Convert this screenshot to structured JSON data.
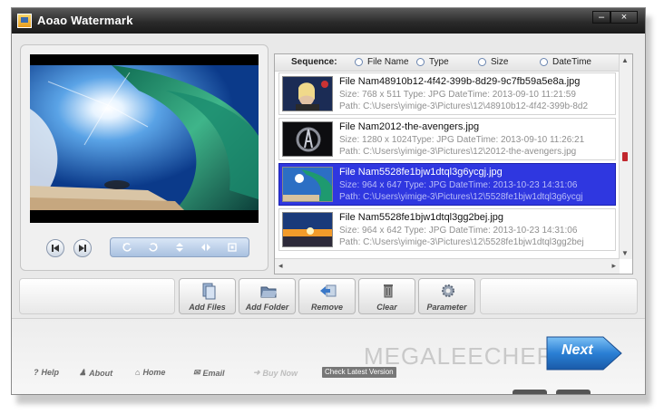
{
  "window": {
    "title": "Aoao Watermark",
    "controls": {
      "minimize": "–",
      "close": "×"
    }
  },
  "player": {
    "controls": [
      "skip-back-icon",
      "skip-forward-icon"
    ],
    "tools": [
      "rotate-left-icon",
      "rotate-right-icon",
      "flip-vertical-icon",
      "flip-horizontal-icon",
      "fit-screen-icon"
    ]
  },
  "sequence": {
    "label": "Sequence:",
    "options": [
      "File Name",
      "Type",
      "Size",
      "DateTime"
    ]
  },
  "files": [
    {
      "name": "File Nam48910b12-4f42-399b-8d29-9c7fb59a5e8a.jpg",
      "meta": "Size: 768 x 511   Type: JPG DateTime: 2013-09-10 11:21:59",
      "path": "Path: C:\\Users\\yimige-3\\Pictures\\12\\48910b12-4f42-399b-8d2",
      "selected": false
    },
    {
      "name": "File Nam2012-the-avengers.jpg",
      "meta": "Size: 1280 x 1024Type: JPG DateTime: 2013-09-10 11:26:21",
      "path": "Path: C:\\Users\\yimige-3\\Pictures\\12\\2012-the-avengers.jpg",
      "selected": false
    },
    {
      "name": "File Nam5528fe1bjw1dtql3g6ycgj.jpg",
      "meta": "Size: 964 x 647   Type: JPG DateTime: 2013-10-23 14:31:06",
      "path": "Path: C:\\Users\\yimige-3\\Pictures\\12\\5528fe1bjw1dtql3g6ycgj",
      "selected": true
    },
    {
      "name": "File Nam5528fe1bjw1dtql3gg2bej.jpg",
      "meta": "Size: 964 x 642   Type: JPG DateTime: 2013-10-23 14:31:06",
      "path": "Path: C:\\Users\\yimige-3\\Pictures\\12\\5528fe1bjw1dtql3gg2bej",
      "selected": false
    }
  ],
  "toolbar": {
    "add_files": "Add Files",
    "add_folder": "Add Folder",
    "remove": "Remove",
    "clear": "Clear",
    "parameter": "Parameter"
  },
  "links": {
    "help": "Help",
    "about": "About",
    "home": "Home",
    "email": "Email",
    "buy_now": "Buy Now",
    "check_version": "Check Latest Version"
  },
  "next_label": "Next",
  "watermark_text": "MEGALEECHER.NET",
  "colors": {
    "selection": "#2f37e0",
    "titlebar": "#2b2b2b",
    "next_button": "#2a7fd4"
  }
}
